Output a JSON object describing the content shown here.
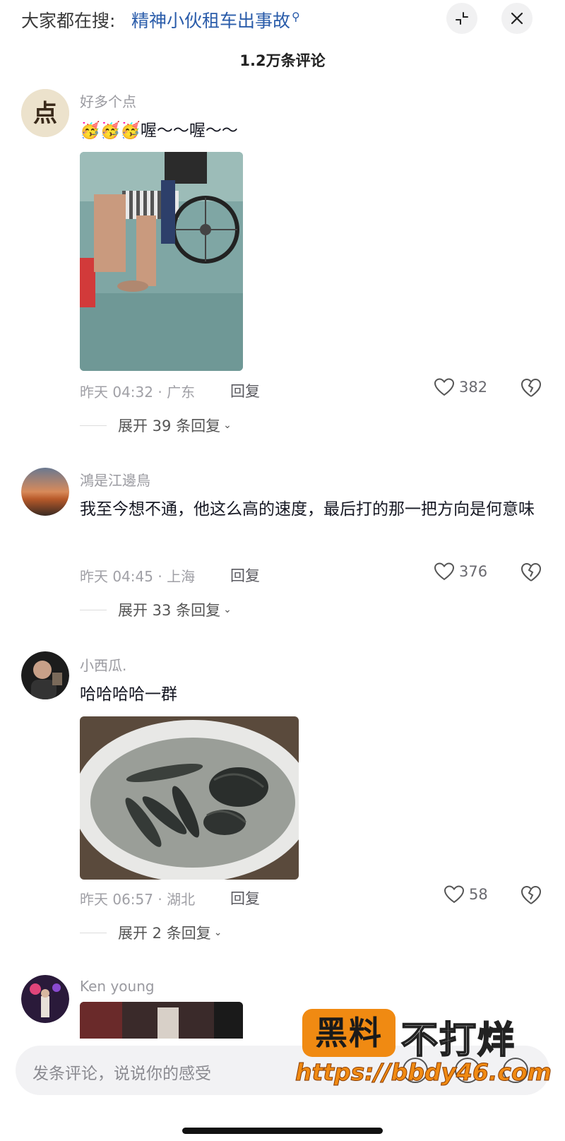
{
  "search": {
    "prefix": "大家都在搜:",
    "term": "精神小伙租车出事故",
    "search_glyph": "⚲"
  },
  "header": {
    "comment_count": "1.2万条评论"
  },
  "comments": [
    {
      "username": "好多个点",
      "avatar_glyph": "点",
      "text": "🥳🥳🥳喔～～喔～～",
      "time_location": "昨天 04:32 · 广东",
      "reply_label": "回复",
      "likes": "382",
      "expand_label": "展开 39 条回复",
      "has_photo": true,
      "photo_subject": "wheelchair"
    },
    {
      "username": "鴻是江邊鳥",
      "text": "我至今想不通，他这么高的速度，最后打的那一把方向是何意味",
      "time_location": "昨天 04:45 · 上海",
      "reply_label": "回复",
      "likes": "376",
      "expand_label": "展开 33 条回复",
      "has_photo": false
    },
    {
      "username": "小西瓜.",
      "text": "哈哈哈哈一群",
      "time_location": "昨天 06:57 · 湖北",
      "reply_label": "回复",
      "likes": "58",
      "expand_label": "展开 2 条回复",
      "has_photo": true,
      "photo_subject": "fish-plate"
    },
    {
      "username": "Ken young",
      "has_photo": true,
      "photo_subject": "stage"
    }
  ],
  "input": {
    "placeholder": "发条评论，说说你的感受"
  },
  "watermark": {
    "badge": "黑料",
    "text": "不打烊",
    "url": "https://bbdy46.com"
  },
  "colors": {
    "search_term": "#2a5caa",
    "watermark_orange": "#f08a12",
    "meta_gray": "#a0a0a6"
  },
  "icons": [
    "collapse-icon",
    "close-icon",
    "heart-icon",
    "dislike-icon",
    "at-icon",
    "emoji-icon"
  ]
}
